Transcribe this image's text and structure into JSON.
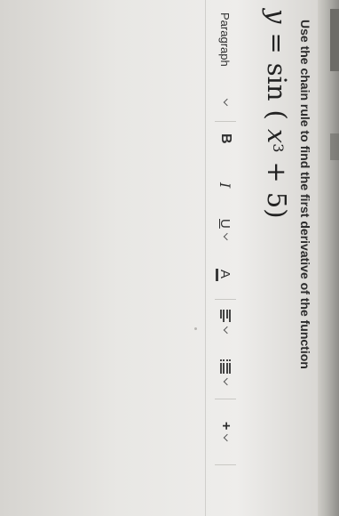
{
  "question": {
    "text": "Use the chain rule to find the first derivative of the function"
  },
  "equation": {
    "lhs": "y",
    "equals": "=",
    "func": "sin",
    "open_paren": "(",
    "base": "x",
    "exponent": "3",
    "plus": "+",
    "constant": "5",
    "close_paren": ")"
  },
  "toolbar": {
    "paragraph_label": "Paragraph",
    "bold_label": "B",
    "italic_label": "I",
    "underline_label": "U",
    "text_color_label": "A",
    "insert_label": "+"
  },
  "icons": {
    "paragraph_dropdown": "chevron-down-icon",
    "underline_dropdown": "chevron-down-icon",
    "text_color": "text-color-icon",
    "align": "align-left-icon",
    "list": "list-icon",
    "insert": "plus-icon"
  },
  "colors": {
    "text": "#2c2c2c",
    "background": "#eeedeb",
    "frame": "#8e8d89"
  }
}
